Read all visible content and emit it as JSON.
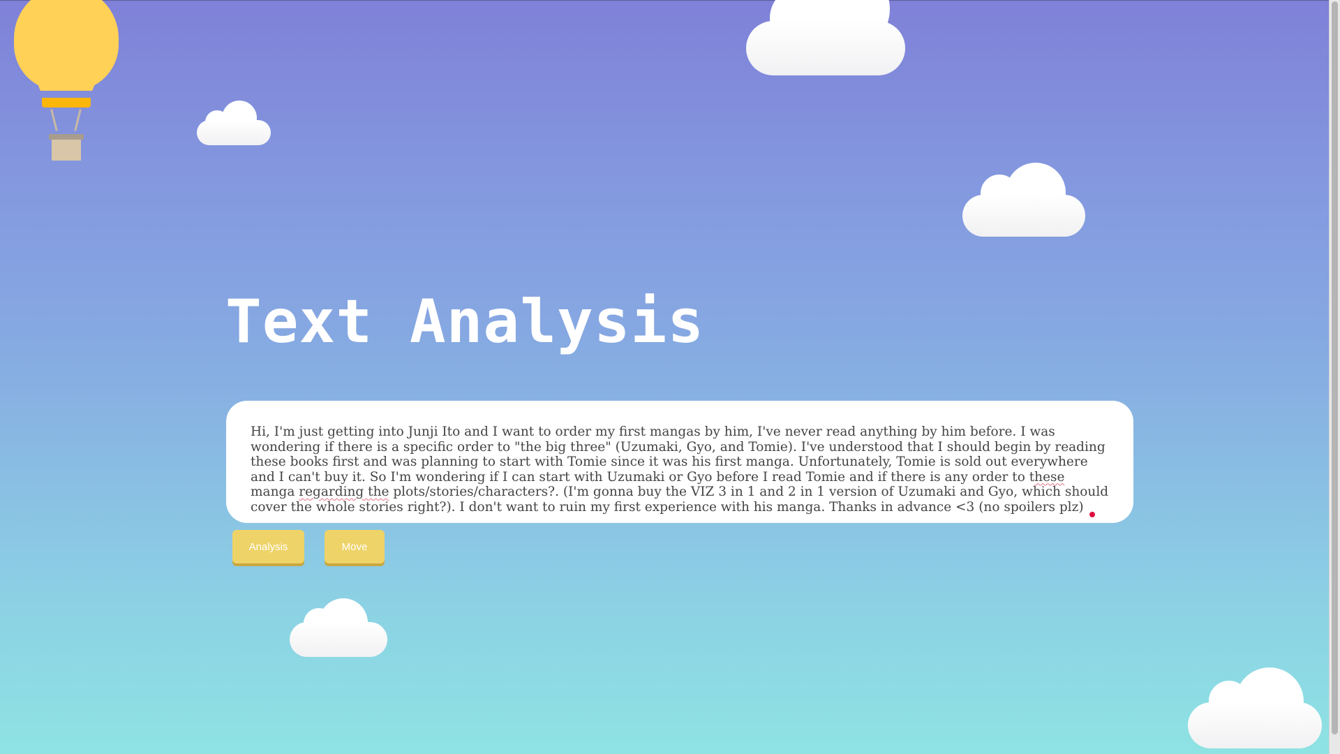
{
  "page": {
    "title": "Text Analysis"
  },
  "textarea": {
    "value_before_these": "Hi, I'm just getting into Junji Ito and I want to order my first mangas by him, I've never read anything by him before. I was wondering if there is a specific order to \"the big three\" (Uzumaki, Gyo, and Tomie). I've understood that I should begin by reading these books first and was planning to start with Tomie since it was his first manga. Unfortunately, Tomie is sold out everywhere and I can't buy it. So I'm wondering if I can start with Uzumaki or Gyo before I read Tomie and if there is any order to t",
    "value_misspelled_1": "hese",
    "value_between": " manga ",
    "value_misspelled_2": "regarding the",
    "value_after": " plots/stories/characters?. (I'm gonna buy the VIZ 3 in 1 and 2 in 1 version of Uzumaki and Gyo, which should cover the whole stories right?). I don't want to ruin my first experience with his manga. Thanks in advance <3 (no spoilers plz)"
  },
  "buttons": {
    "analysis_label": "Analysis",
    "move_label": "Move"
  },
  "colors": {
    "button": "#eed369",
    "button_shadow": "#c9a73f",
    "balloon": "#ffd157",
    "balloon_band": "#ffb60b",
    "spellcheck_underline": "#e8708a",
    "status_dot": "#e0103e"
  }
}
